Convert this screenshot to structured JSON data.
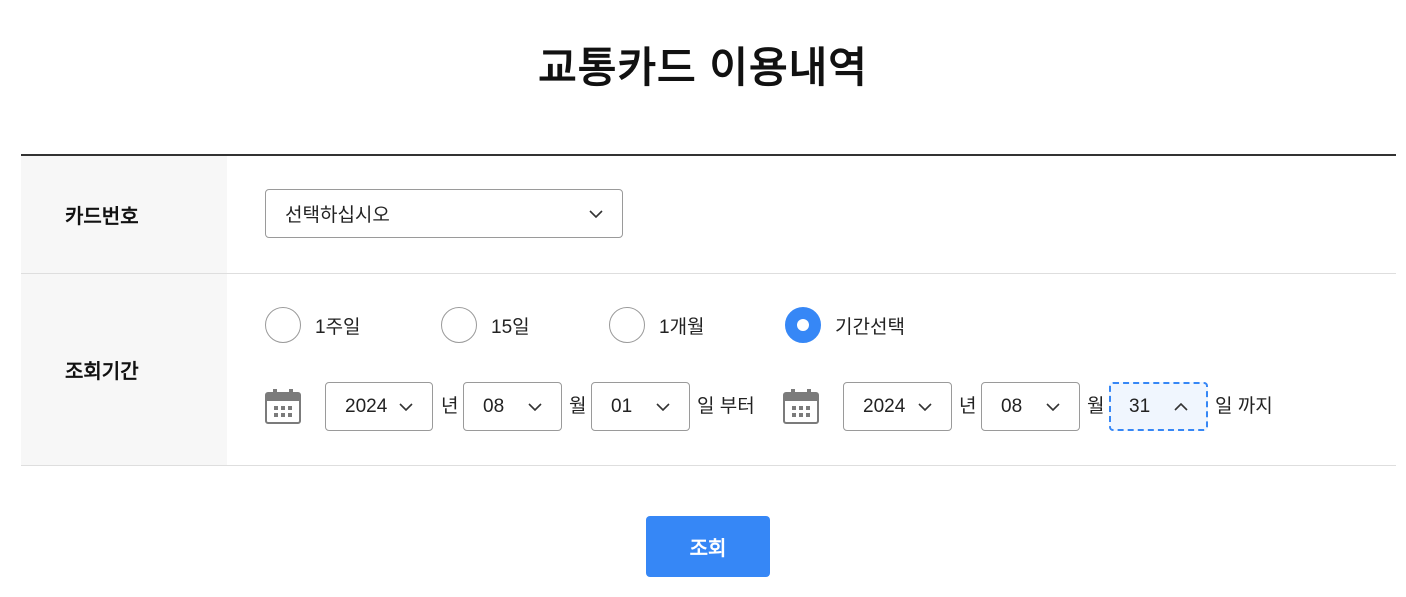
{
  "page": {
    "title": "교통카드 이용내역"
  },
  "form": {
    "card_number": {
      "label": "카드번호",
      "select": {
        "value": "선택하십시오"
      }
    },
    "period": {
      "label": "조회기간",
      "options": [
        {
          "label": "1주일",
          "selected": false
        },
        {
          "label": "15일",
          "selected": false
        },
        {
          "label": "1개월",
          "selected": false
        },
        {
          "label": "기간선택",
          "selected": true
        }
      ],
      "start": {
        "year": "2024",
        "year_unit": "년",
        "month": "08",
        "month_unit": "월",
        "day": "01",
        "day_unit": "일 부터"
      },
      "end": {
        "year": "2024",
        "year_unit": "년",
        "month": "08",
        "month_unit": "월",
        "day": "31",
        "day_unit": "일 까지"
      }
    }
  },
  "actions": {
    "search_label": "조회"
  },
  "icons": {
    "select_arrow": "chevron-down-icon",
    "open_select_arrow": "chevron-up-icon",
    "date_picker": "calendar-icon"
  },
  "colors": {
    "accent": "#3687f6",
    "header_rule": "#333333",
    "label_background": "#f7f7f7",
    "focus_background": "#f0f6fe"
  }
}
